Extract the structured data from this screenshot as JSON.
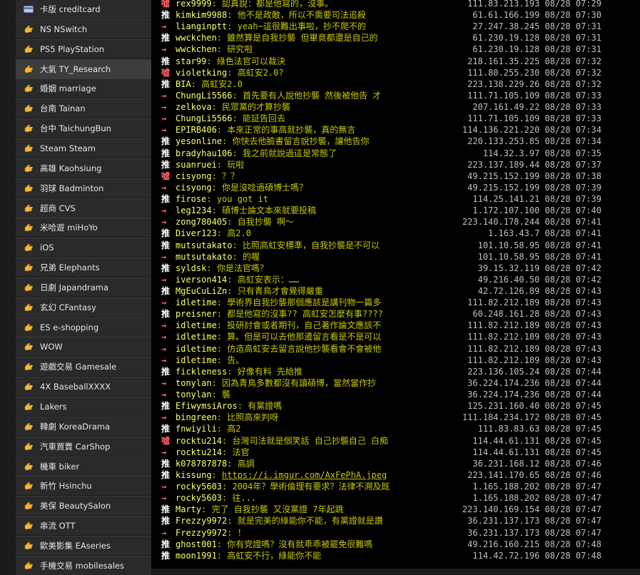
{
  "sidebar": {
    "items": [
      {
        "label": "卡版 creditcard",
        "icon": "credit-card-icon",
        "active": false
      },
      {
        "label": "NS NSwitch",
        "icon": "hand-pointer-icon",
        "active": false
      },
      {
        "label": "PS5 PlayStation",
        "icon": "hand-pointer-icon",
        "active": false
      },
      {
        "label": "大氣 TY_Research",
        "icon": "hand-pointer-icon",
        "active": true
      },
      {
        "label": "婚姻 marriage",
        "icon": "hand-pointer-icon",
        "active": false
      },
      {
        "label": "台南 Tainan",
        "icon": "hand-pointer-icon",
        "active": false
      },
      {
        "label": "台中 TaichungBun",
        "icon": "hand-pointer-icon",
        "active": false
      },
      {
        "label": "Steam Steam",
        "icon": "hand-pointer-icon",
        "active": false
      },
      {
        "label": "高雄 Kaohsiung",
        "icon": "hand-pointer-icon",
        "active": false
      },
      {
        "label": "羽球 Badminton",
        "icon": "hand-pointer-icon",
        "active": false
      },
      {
        "label": "超商 CVS",
        "icon": "hand-pointer-icon",
        "active": false
      },
      {
        "label": "米哈遊 miHoYo",
        "icon": "hand-pointer-icon",
        "active": false
      },
      {
        "label": "iOS",
        "icon": "hand-pointer-icon",
        "active": false
      },
      {
        "label": "兄弟 Elephants",
        "icon": "hand-pointer-icon",
        "active": false
      },
      {
        "label": "日劇 Japandrama",
        "icon": "hand-pointer-icon",
        "active": false
      },
      {
        "label": "玄幻 CFantasy",
        "icon": "hand-pointer-icon",
        "active": false
      },
      {
        "label": "ES e-shopping",
        "icon": "hand-pointer-icon",
        "active": false
      },
      {
        "label": "WOW",
        "icon": "hand-pointer-icon",
        "active": false
      },
      {
        "label": "遊戲交易 Gamesale",
        "icon": "hand-pointer-icon",
        "active": false
      },
      {
        "label": "4X BaseballXXXX",
        "icon": "hand-pointer-icon",
        "active": false
      },
      {
        "label": "Lakers",
        "icon": "hand-pointer-icon",
        "active": false
      },
      {
        "label": "韓劇 KoreaDrama",
        "icon": "hand-pointer-icon",
        "active": false
      },
      {
        "label": "汽車買賣 CarShop",
        "icon": "hand-pointer-icon",
        "active": false
      },
      {
        "label": "機車 biker",
        "icon": "hand-pointer-icon",
        "active": false
      },
      {
        "label": "新竹 Hsinchu",
        "icon": "hand-pointer-icon",
        "active": false
      },
      {
        "label": "美保 BeautySalon",
        "icon": "hand-pointer-icon",
        "active": false
      },
      {
        "label": "串流 OTT",
        "icon": "hand-pointer-icon",
        "active": false
      },
      {
        "label": "歐美影集 EAseries",
        "icon": "hand-pointer-icon",
        "active": false
      },
      {
        "label": "手機交易 mobilesales",
        "icon": "hand-pointer-icon",
        "active": false
      }
    ]
  },
  "pushes": [
    {
      "tag": "噓",
      "kind": "down",
      "user": "rex9999",
      "content": "認真說：都是他寫的，沒事。",
      "ipdt": "111.83.213.193 08/28 07:29"
    },
    {
      "tag": "推",
      "kind": "up",
      "user": "kimkim9988",
      "content": "他不是政敵，所以不需要司法追殺",
      "ipdt": "61.61.166.199 08/28 07:30"
    },
    {
      "tag": "→",
      "kind": "arrow",
      "user": "lianginptt",
      "content": "yeah~這很難出事啦，抄不爬不的",
      "ipdt": "27.247.38.245 08/28 07:31"
    },
    {
      "tag": "推",
      "kind": "up",
      "user": "wwckchen",
      "content": "雖然算是自我抄襲 但畢竟都還是自己的",
      "ipdt": "61.230.19.128 08/28 07:31"
    },
    {
      "tag": "→",
      "kind": "arrow",
      "user": "wwckchen",
      "content": "研究啦",
      "ipdt": "61.230.19.128 08/28 07:31"
    },
    {
      "tag": "推",
      "kind": "up",
      "user": "star99",
      "content": "綠色法官可以裁決",
      "ipdt": "218.161.35.225 08/28 07:32"
    },
    {
      "tag": "噓",
      "kind": "down",
      "user": "violetking",
      "content": "高虹安2.0?",
      "ipdt": "111.80.255.230 08/28 07:32"
    },
    {
      "tag": "推",
      "kind": "up",
      "user": "BIA",
      "content": "高虹安2.0",
      "ipdt": "223.138.229.26 08/28 07:32"
    },
    {
      "tag": "→",
      "kind": "arrow",
      "user": "ChungLi5566",
      "content": "首先要有人說他抄襲 然後被他告 才",
      "ipdt": "111.71.105.109 08/28 07:33"
    },
    {
      "tag": "→",
      "kind": "arrow",
      "user": "zelkova",
      "content": "民眾黨的才算抄襲",
      "ipdt": "207.161.49.22 08/28 07:33"
    },
    {
      "tag": "→",
      "kind": "arrow",
      "user": "ChungLi5566",
      "content": "能証告回去",
      "ipdt": "111.71.105.109 08/28 07:33"
    },
    {
      "tag": "→",
      "kind": "arrow",
      "user": "EPIRB406",
      "content": "本來正常的事高就抄襲，真的無言",
      "ipdt": "114.136.221.220 08/28 07:34"
    },
    {
      "tag": "推",
      "kind": "up",
      "user": "yesonline",
      "content": "你快去他臉書留言說抄襲，讓他告你",
      "ipdt": "220.133.253.85 08/28 07:34"
    },
    {
      "tag": "推",
      "kind": "up",
      "user": "bradyhau106",
      "content": "我之前就說過這是常態了",
      "ipdt": "114.32.3.97 08/28 07:35"
    },
    {
      "tag": "推",
      "kind": "up",
      "user": "suanruei",
      "content": "玩啦",
      "ipdt": "223.137.189.44 08/28 07:37"
    },
    {
      "tag": "噓",
      "kind": "down",
      "user": "cisyong",
      "content": "？？",
      "ipdt": "49.215.152.199 08/28 07:38"
    },
    {
      "tag": "→",
      "kind": "arrow",
      "user": "cisyong",
      "content": "你是沒唸過碩博士嗎？",
      "ipdt": "49.215.152.199 08/28 07:39"
    },
    {
      "tag": "推",
      "kind": "up",
      "user": "firose",
      "content": "you got it",
      "ipdt": "114.25.141.21 08/28 07:39"
    },
    {
      "tag": "→",
      "kind": "arrow",
      "user": "leg1234",
      "content": "碩博士論文本來就要投稿",
      "ipdt": "1.172.107.100 08/28 07:40"
    },
    {
      "tag": "→",
      "kind": "arrow",
      "user": "zong780405",
      "content": "自我抄襲 啊～",
      "ipdt": "223.140.178.244 08/28 07:41"
    },
    {
      "tag": "推",
      "kind": "up",
      "user": "Diver123",
      "content": "高2.0",
      "ipdt": "1.163.43.7 08/28 07:41"
    },
    {
      "tag": "推",
      "kind": "up",
      "user": "mutsutakato",
      "content": "比照高虹安標準，自我抄襲是不可以",
      "ipdt": "101.10.58.95 08/28 07:41"
    },
    {
      "tag": "→",
      "kind": "arrow",
      "user": "mutsutakato",
      "content": "的喔",
      "ipdt": "101.10.58.95 08/28 07:41"
    },
    {
      "tag": "推",
      "kind": "up",
      "user": "syldsk",
      "content": "你是法官嗎？",
      "ipdt": "39.15.32.119 08/28 07:42"
    },
    {
      "tag": "→",
      "kind": "arrow",
      "user": "iverson414",
      "content": "高虹安表示：……",
      "ipdt": "49.216.40.50 08/28 07:42"
    },
    {
      "tag": "推",
      "kind": "up",
      "user": "MgEuCuLiZn",
      "content": "只有青鳥才會覺得嚴重",
      "ipdt": "42.72.126.89 08/28 07:43"
    },
    {
      "tag": "→",
      "kind": "arrow",
      "user": "idletime",
      "content": "學術界自我抄襲那個應該是講刊物一篇多",
      "ipdt": "111.82.212.189 08/28 07:43"
    },
    {
      "tag": "推",
      "kind": "up",
      "user": "preisner",
      "content": "都是他寫的沒事?? 高虹安怎麼有事????",
      "ipdt": "60.248.161.28 08/28 07:43"
    },
    {
      "tag": "→",
      "kind": "arrow",
      "user": "idletime",
      "content": "投研討會或者期刊，自己著作論文應該不",
      "ipdt": "111.82.212.189 08/28 07:43"
    },
    {
      "tag": "→",
      "kind": "arrow",
      "user": "idletime",
      "content": "算。但是可以去他那邊留言看是不是可以",
      "ipdt": "111.82.212.189 08/28 07:43"
    },
    {
      "tag": "→",
      "kind": "arrow",
      "user": "idletime",
      "content": "仿造高虹安去留言說他抄襲看會不會被他",
      "ipdt": "111.82.212.189 08/28 07:43"
    },
    {
      "tag": "→",
      "kind": "arrow",
      "user": "idletime",
      "content": "告。",
      "ipdt": "111.82.212.189 08/28 07:43"
    },
    {
      "tag": "推",
      "kind": "up",
      "user": "fickleness",
      "content": "好像有料 先給推",
      "ipdt": "223.136.105.24 08/28 07:44"
    },
    {
      "tag": "→",
      "kind": "arrow",
      "user": "tonylan",
      "content": "因為青鳥多數都沒有讀碩博，當然當作抄",
      "ipdt": "36.224.174.236 08/28 07:44"
    },
    {
      "tag": "→",
      "kind": "arrow",
      "user": "tonylan",
      "content": "襲",
      "ipdt": "36.224.174.236 08/28 07:44"
    },
    {
      "tag": "推",
      "kind": "up",
      "user": "EfiwymsiAros",
      "content": "有黨證嗎",
      "ipdt": "125.231.160.40 08/28 07:45"
    },
    {
      "tag": "→",
      "kind": "arrow",
      "user": "bingreen",
      "content": "比照高來判呀",
      "ipdt": "111.184.234.172 08/28 07:45"
    },
    {
      "tag": "推",
      "kind": "up",
      "user": "fnwiyili",
      "content": "高2",
      "ipdt": "111.83.83.63 08/28 07:45"
    },
    {
      "tag": "噓",
      "kind": "down",
      "user": "rocktu214",
      "content": "台灣司法就是個笑話 自己抄襲自己 白痴",
      "ipdt": "114.44.61.131 08/28 07:45"
    },
    {
      "tag": "→",
      "kind": "arrow",
      "user": "rocktu214",
      "content": "法官",
      "ipdt": "114.44.61.131 08/28 07:45"
    },
    {
      "tag": "推",
      "kind": "up",
      "user": "k078787878",
      "content": "高調",
      "ipdt": "36.231.168.12 08/28 07:46"
    },
    {
      "tag": "推",
      "kind": "up",
      "user": "kissung",
      "content": "https://i.imgur.com/AxFePhA.jpeg",
      "link": true,
      "ipdt": "223.141.170.65 08/28 07:46"
    },
    {
      "tag": "→",
      "kind": "arrow",
      "user": "rocky5603",
      "content": "2004年？學術倫理有要求？法律不溯及既",
      "ipdt": "1.165.188.202 08/28 07:47"
    },
    {
      "tag": "→",
      "kind": "arrow",
      "user": "rocky5603",
      "content": "往...",
      "ipdt": "1.165.188.202 08/28 07:47"
    },
    {
      "tag": "推",
      "kind": "up",
      "user": "Marty",
      "content": "完了 自我抄襲 又沒黨證 7年起跳",
      "ipdt": "223.140.169.154 08/28 07:47"
    },
    {
      "tag": "推",
      "kind": "up",
      "user": "Frezzy9972",
      "content": "就是完美的綠能你不能，有黨證就是讚",
      "ipdt": "36.231.137.173 08/28 07:47"
    },
    {
      "tag": "→",
      "kind": "arrow",
      "user": "Frezzy9972",
      "content": "！",
      "ipdt": "36.231.137.173 08/28 07:47"
    },
    {
      "tag": "推",
      "kind": "up",
      "user": "ghost001",
      "content": "你有党證嗎？沒有就乖乖被罷免很難嗎",
      "ipdt": "49.216.160.215 08/28 07:48"
    },
    {
      "tag": "推",
      "kind": "up",
      "user": "moon1991",
      "content": "高虹安不行，綠能你不能",
      "ipdt": "114.42.72.196 08/28 07:48"
    }
  ]
}
